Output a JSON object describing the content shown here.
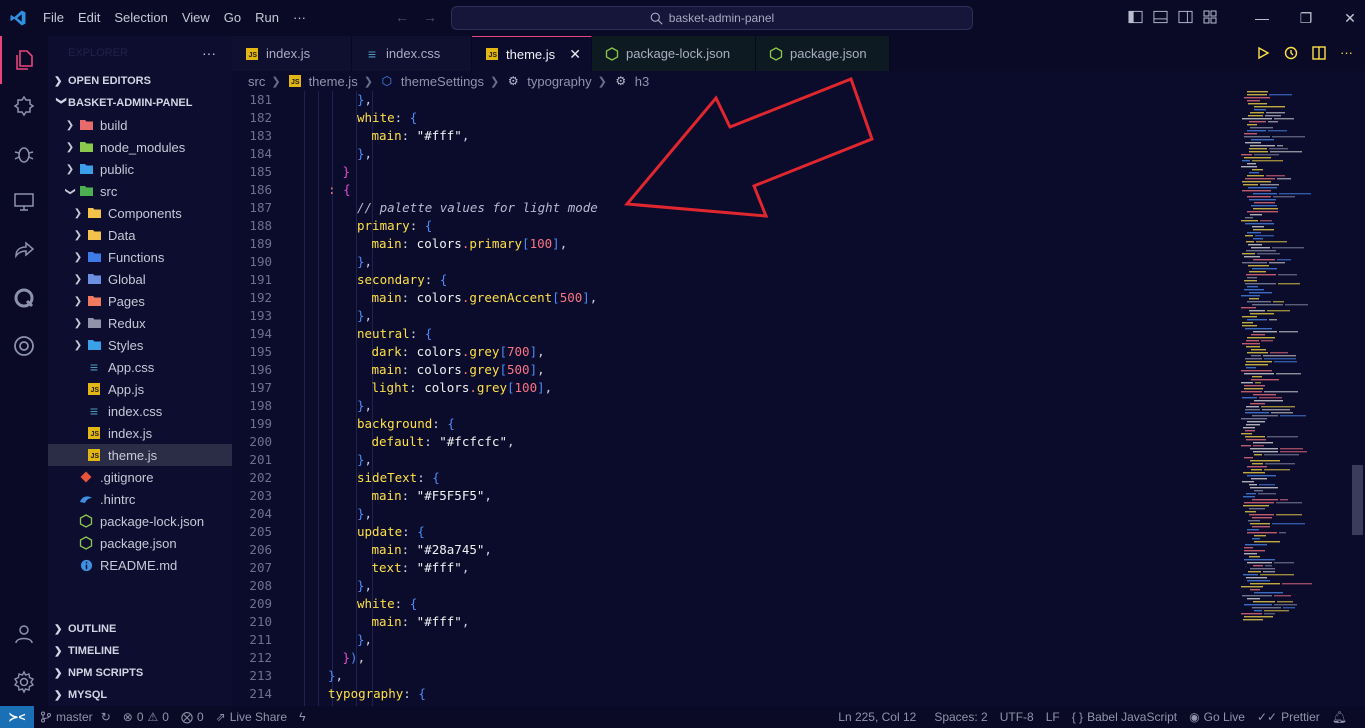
{
  "titlebar": {
    "menu": [
      "File",
      "Edit",
      "Selection",
      "View",
      "Go",
      "Run",
      "···"
    ],
    "search_text": "basket-admin-panel",
    "accent": "#1a6fb5"
  },
  "sidebar": {
    "header": "EXPLORER",
    "open_editors": "OPEN EDITORS",
    "project": "BASKET-ADMIN-PANEL",
    "tree": [
      {
        "label": "build",
        "type": "folder",
        "depth": 0,
        "icon": "build-folder-icon"
      },
      {
        "label": "node_modules",
        "type": "folder",
        "depth": 0,
        "icon": "node-modules-folder-icon"
      },
      {
        "label": "public",
        "type": "folder",
        "depth": 0,
        "icon": "public-folder-icon"
      },
      {
        "label": "src",
        "type": "folder-open",
        "depth": 0,
        "icon": "src-folder-icon"
      },
      {
        "label": "Components",
        "type": "folder",
        "depth": 1,
        "icon": "components-folder-icon"
      },
      {
        "label": "Data",
        "type": "folder",
        "depth": 1,
        "icon": "data-folder-icon"
      },
      {
        "label": "Functions",
        "type": "folder",
        "depth": 1,
        "icon": "functions-folder-icon"
      },
      {
        "label": "Global",
        "type": "folder",
        "depth": 1,
        "icon": "global-folder-icon"
      },
      {
        "label": "Pages",
        "type": "folder",
        "depth": 1,
        "icon": "pages-folder-icon"
      },
      {
        "label": "Redux",
        "type": "folder",
        "depth": 1,
        "icon": "redux-folder-icon"
      },
      {
        "label": "Styles",
        "type": "folder",
        "depth": 1,
        "icon": "styles-folder-icon"
      },
      {
        "label": "App.css",
        "type": "css",
        "depth": 1,
        "icon": "css-file-icon"
      },
      {
        "label": "App.js",
        "type": "js",
        "depth": 1,
        "icon": "js-file-icon"
      },
      {
        "label": "index.css",
        "type": "css",
        "depth": 1,
        "icon": "css-file-icon"
      },
      {
        "label": "index.js",
        "type": "js",
        "depth": 1,
        "icon": "js-file-icon"
      },
      {
        "label": "theme.js",
        "type": "js",
        "depth": 1,
        "icon": "js-file-icon",
        "selected": true
      },
      {
        "label": ".gitignore",
        "type": "git",
        "depth": 0,
        "icon": "git-file-icon"
      },
      {
        "label": ".hintrc",
        "type": "hint",
        "depth": 0,
        "icon": "hint-file-icon"
      },
      {
        "label": "package-lock.json",
        "type": "node",
        "depth": 0,
        "icon": "nodejs-file-icon"
      },
      {
        "label": "package.json",
        "type": "node",
        "depth": 0,
        "icon": "nodejs-file-icon"
      },
      {
        "label": "README.md",
        "type": "info",
        "depth": 0,
        "icon": "info-file-icon"
      }
    ],
    "bottom_sections": [
      "OUTLINE",
      "TIMELINE",
      "NPM SCRIPTS",
      "MYSQL"
    ]
  },
  "tabs": [
    {
      "label": "index.js",
      "icon": "js-file-icon"
    },
    {
      "label": "index.css",
      "icon": "css-file-icon"
    },
    {
      "label": "theme.js",
      "icon": "js-file-icon",
      "active": true
    },
    {
      "label": "package-lock.json",
      "icon": "nodejs-file-icon"
    },
    {
      "label": "package.json",
      "icon": "nodejs-file-icon"
    }
  ],
  "breadcrumb": [
    "src",
    "theme.js",
    "themeSettings",
    "typography",
    "h3"
  ],
  "editor": {
    "lines": [
      {
        "n": "181",
        "indent": 4,
        "tokens": [
          [
            "}",
            "tok-brace"
          ],
          [
            ",",
            "tok-punct"
          ]
        ]
      },
      {
        "n": "182",
        "indent": 4,
        "tokens": [
          [
            "white",
            "tok-key"
          ],
          [
            ": ",
            "tok-punct"
          ],
          [
            "{",
            "tok-brace"
          ]
        ]
      },
      {
        "n": "183",
        "indent": 5,
        "tokens": [
          [
            "main",
            "tok-key"
          ],
          [
            ": ",
            "tok-punct"
          ],
          [
            "\"#fff\"",
            "tok-str"
          ],
          [
            ",",
            "tok-punct"
          ]
        ]
      },
      {
        "n": "184",
        "indent": 4,
        "tokens": [
          [
            "}",
            "tok-brace"
          ],
          [
            ",",
            "tok-punct"
          ]
        ]
      },
      {
        "n": "185",
        "indent": 3,
        "tokens": [
          [
            "}",
            "tok-brace2"
          ]
        ]
      },
      {
        "n": "186",
        "indent": 2,
        "tokens": [
          [
            ": ",
            "tok-dot"
          ],
          [
            "{",
            "tok-brace2"
          ]
        ]
      },
      {
        "n": "187",
        "indent": 4,
        "tokens": [
          [
            "// palette values for light mode",
            "tok-comment"
          ]
        ]
      },
      {
        "n": "188",
        "indent": 4,
        "tokens": [
          [
            "primary",
            "tok-key"
          ],
          [
            ": ",
            "tok-punct"
          ],
          [
            "{",
            "tok-brace"
          ]
        ]
      },
      {
        "n": "189",
        "indent": 5,
        "tokens": [
          [
            "main",
            "tok-key"
          ],
          [
            ": ",
            "tok-punct"
          ],
          [
            "colors",
            "tok-ident"
          ],
          [
            ".",
            "tok-dot"
          ],
          [
            "primary",
            "tok-key"
          ],
          [
            "[",
            "tok-brace"
          ],
          [
            "100",
            "tok-num"
          ],
          [
            "]",
            "tok-brace"
          ],
          [
            ",",
            "tok-punct"
          ]
        ]
      },
      {
        "n": "190",
        "indent": 4,
        "tokens": [
          [
            "}",
            "tok-brace"
          ],
          [
            ",",
            "tok-punct"
          ]
        ]
      },
      {
        "n": "191",
        "indent": 4,
        "tokens": [
          [
            "secondary",
            "tok-key"
          ],
          [
            ": ",
            "tok-punct"
          ],
          [
            "{",
            "tok-brace"
          ]
        ]
      },
      {
        "n": "192",
        "indent": 5,
        "tokens": [
          [
            "main",
            "tok-key"
          ],
          [
            ": ",
            "tok-punct"
          ],
          [
            "colors",
            "tok-ident"
          ],
          [
            ".",
            "tok-dot"
          ],
          [
            "greenAccent",
            "tok-key"
          ],
          [
            "[",
            "tok-brace"
          ],
          [
            "500",
            "tok-num"
          ],
          [
            "]",
            "tok-brace"
          ],
          [
            ",",
            "tok-punct"
          ]
        ]
      },
      {
        "n": "193",
        "indent": 4,
        "tokens": [
          [
            "}",
            "tok-brace"
          ],
          [
            ",",
            "tok-punct"
          ]
        ]
      },
      {
        "n": "194",
        "indent": 4,
        "tokens": [
          [
            "neutral",
            "tok-key"
          ],
          [
            ": ",
            "tok-punct"
          ],
          [
            "{",
            "tok-brace"
          ]
        ]
      },
      {
        "n": "195",
        "indent": 5,
        "tokens": [
          [
            "dark",
            "tok-key"
          ],
          [
            ": ",
            "tok-punct"
          ],
          [
            "colors",
            "tok-ident"
          ],
          [
            ".",
            "tok-dot"
          ],
          [
            "grey",
            "tok-key"
          ],
          [
            "[",
            "tok-brace"
          ],
          [
            "700",
            "tok-num"
          ],
          [
            "]",
            "tok-brace"
          ],
          [
            ",",
            "tok-punct"
          ]
        ]
      },
      {
        "n": "196",
        "indent": 5,
        "tokens": [
          [
            "main",
            "tok-key"
          ],
          [
            ": ",
            "tok-punct"
          ],
          [
            "colors",
            "tok-ident"
          ],
          [
            ".",
            "tok-dot"
          ],
          [
            "grey",
            "tok-key"
          ],
          [
            "[",
            "tok-brace"
          ],
          [
            "500",
            "tok-num"
          ],
          [
            "]",
            "tok-brace"
          ],
          [
            ",",
            "tok-punct"
          ]
        ]
      },
      {
        "n": "197",
        "indent": 5,
        "tokens": [
          [
            "light",
            "tok-key"
          ],
          [
            ": ",
            "tok-punct"
          ],
          [
            "colors",
            "tok-ident"
          ],
          [
            ".",
            "tok-dot"
          ],
          [
            "grey",
            "tok-key"
          ],
          [
            "[",
            "tok-brace"
          ],
          [
            "100",
            "tok-num"
          ],
          [
            "]",
            "tok-brace"
          ],
          [
            ",",
            "tok-punct"
          ]
        ]
      },
      {
        "n": "198",
        "indent": 4,
        "tokens": [
          [
            "}",
            "tok-brace"
          ],
          [
            ",",
            "tok-punct"
          ]
        ]
      },
      {
        "n": "199",
        "indent": 4,
        "tokens": [
          [
            "background",
            "tok-key"
          ],
          [
            ": ",
            "tok-punct"
          ],
          [
            "{",
            "tok-brace"
          ]
        ]
      },
      {
        "n": "200",
        "indent": 5,
        "tokens": [
          [
            "default",
            "tok-key"
          ],
          [
            ": ",
            "tok-punct"
          ],
          [
            "\"#fcfcfc\"",
            "tok-str"
          ],
          [
            ",",
            "tok-punct"
          ]
        ]
      },
      {
        "n": "201",
        "indent": 4,
        "tokens": [
          [
            "}",
            "tok-brace"
          ],
          [
            ",",
            "tok-punct"
          ]
        ]
      },
      {
        "n": "202",
        "indent": 4,
        "tokens": [
          [
            "sideText",
            "tok-key"
          ],
          [
            ": ",
            "tok-punct"
          ],
          [
            "{",
            "tok-brace"
          ]
        ]
      },
      {
        "n": "203",
        "indent": 5,
        "tokens": [
          [
            "main",
            "tok-key"
          ],
          [
            ": ",
            "tok-punct"
          ],
          [
            "\"#F5F5F5\"",
            "tok-str"
          ],
          [
            ",",
            "tok-punct"
          ]
        ]
      },
      {
        "n": "204",
        "indent": 4,
        "tokens": [
          [
            "}",
            "tok-brace"
          ],
          [
            ",",
            "tok-punct"
          ]
        ]
      },
      {
        "n": "205",
        "indent": 4,
        "tokens": [
          [
            "update",
            "tok-key"
          ],
          [
            ": ",
            "tok-punct"
          ],
          [
            "{",
            "tok-brace"
          ]
        ]
      },
      {
        "n": "206",
        "indent": 5,
        "tokens": [
          [
            "main",
            "tok-key"
          ],
          [
            ": ",
            "tok-punct"
          ],
          [
            "\"#28a745\"",
            "tok-str"
          ],
          [
            ",",
            "tok-punct"
          ]
        ]
      },
      {
        "n": "207",
        "indent": 5,
        "tokens": [
          [
            "text",
            "tok-key"
          ],
          [
            ": ",
            "tok-punct"
          ],
          [
            "\"#fff\"",
            "tok-str"
          ],
          [
            ",",
            "tok-punct"
          ]
        ]
      },
      {
        "n": "208",
        "indent": 4,
        "tokens": [
          [
            "}",
            "tok-brace"
          ],
          [
            ",",
            "tok-punct"
          ]
        ]
      },
      {
        "n": "209",
        "indent": 4,
        "tokens": [
          [
            "white",
            "tok-key"
          ],
          [
            ": ",
            "tok-punct"
          ],
          [
            "{",
            "tok-brace"
          ]
        ]
      },
      {
        "n": "210",
        "indent": 5,
        "tokens": [
          [
            "main",
            "tok-key"
          ],
          [
            ": ",
            "tok-punct"
          ],
          [
            "\"#fff\"",
            "tok-str"
          ],
          [
            ",",
            "tok-punct"
          ]
        ]
      },
      {
        "n": "211",
        "indent": 4,
        "tokens": [
          [
            "}",
            "tok-brace"
          ],
          [
            ",",
            "tok-punct"
          ]
        ]
      },
      {
        "n": "212",
        "indent": 3,
        "tokens": [
          [
            "}",
            "tok-brace2"
          ],
          [
            ")",
            "tok-brace"
          ],
          [
            ",",
            "tok-punct"
          ]
        ]
      },
      {
        "n": "213",
        "indent": 2,
        "tokens": [
          [
            "}",
            "tok-brace"
          ],
          [
            ",",
            "tok-punct"
          ]
        ]
      },
      {
        "n": "214",
        "indent": 2,
        "tokens": [
          [
            "typography",
            "tok-key"
          ],
          [
            ": ",
            "tok-punct"
          ],
          [
            "{",
            "tok-brace"
          ]
        ]
      }
    ]
  },
  "statusbar": {
    "branch": "master",
    "errors": "0",
    "warnings": "0",
    "ports": "0",
    "live_share": "Live Share",
    "position": "Ln 225, Col 12",
    "spaces": "Spaces: 2",
    "encoding": "UTF-8",
    "eol": "LF",
    "language": "Babel JavaScript",
    "go_live": "Go Live",
    "prettier": "Prettier"
  },
  "annotation": {
    "color": "#e0262e"
  }
}
